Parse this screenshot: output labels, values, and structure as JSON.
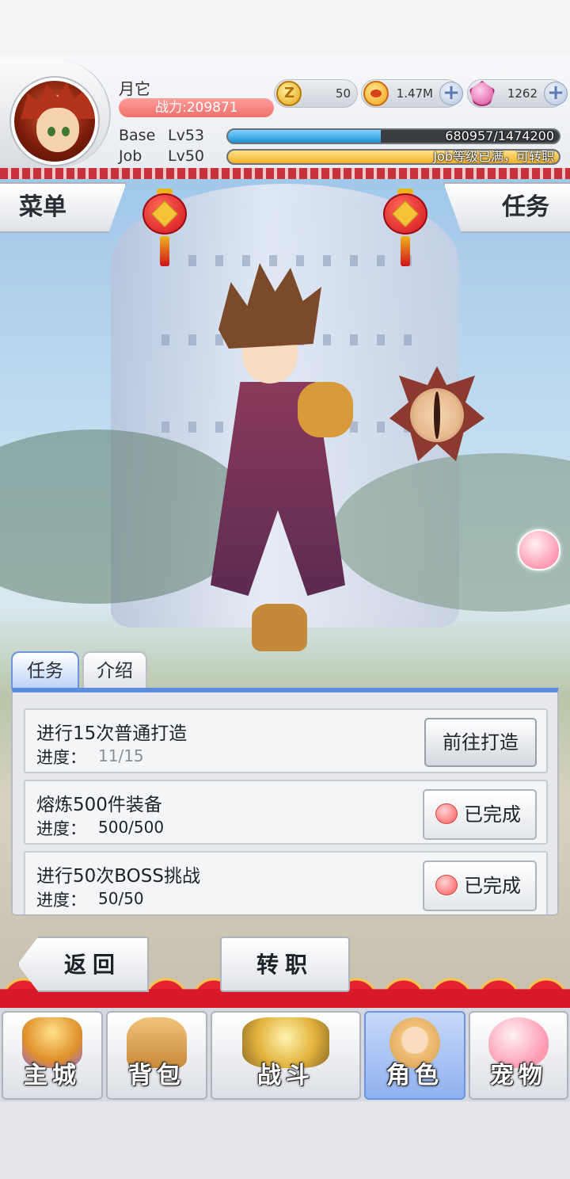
{
  "player": {
    "name": "月它",
    "power": "战力:209871"
  },
  "currencies": [
    {
      "name": "zeny",
      "icon": "zeny-coin-icon",
      "value": "50",
      "has_plus": false
    },
    {
      "name": "gold",
      "icon": "gold-ingot-icon",
      "value": "1.47M",
      "has_plus": true
    },
    {
      "name": "gem",
      "icon": "gem-icon",
      "value": "1262",
      "has_plus": true
    }
  ],
  "levels": {
    "base_label": "Base",
    "base_level": "Lv53",
    "base_exp": "680957/1474200",
    "base_progress": 0.462,
    "job_label": "Job",
    "job_level": "Lv50",
    "job_text": "Job等级已满，可转职",
    "job_progress": 1.0
  },
  "scene": {
    "menu_button": "菜单",
    "task_button": "任务"
  },
  "tabs": [
    {
      "label": "任务",
      "active": true
    },
    {
      "label": "介绍",
      "active": false
    }
  ],
  "quests": [
    {
      "title": "进行15次普通打造",
      "progress_label": "进度：",
      "progress": "11/15",
      "action": "前往打造",
      "completed": false
    },
    {
      "title": "熔炼500件装备",
      "progress_label": "进度：",
      "progress": "500/500",
      "action": "已完成",
      "completed": true
    },
    {
      "title": "进行50次BOSS挑战",
      "progress_label": "进度：",
      "progress": "50/50",
      "action": "已完成",
      "completed": true
    }
  ],
  "bottom_buttons": {
    "back": "返回",
    "job_change": "转职"
  },
  "nav": [
    {
      "label": "主城",
      "icon": "castle-icon",
      "active": false
    },
    {
      "label": "背包",
      "icon": "backpack-icon",
      "active": false
    },
    {
      "label": "战斗",
      "icon": "battle-crest-icon",
      "active": false
    },
    {
      "label": "角色",
      "icon": "character-icon",
      "active": true
    },
    {
      "label": "宠物",
      "icon": "poring-pet-icon",
      "active": false
    }
  ],
  "colors": {
    "accent_blue": "#5c8ddf",
    "power_red": "#ee6f6b",
    "base_bar": "#1f8fd6",
    "job_bar": "#f2b02a",
    "festive_red": "#d8192a"
  }
}
